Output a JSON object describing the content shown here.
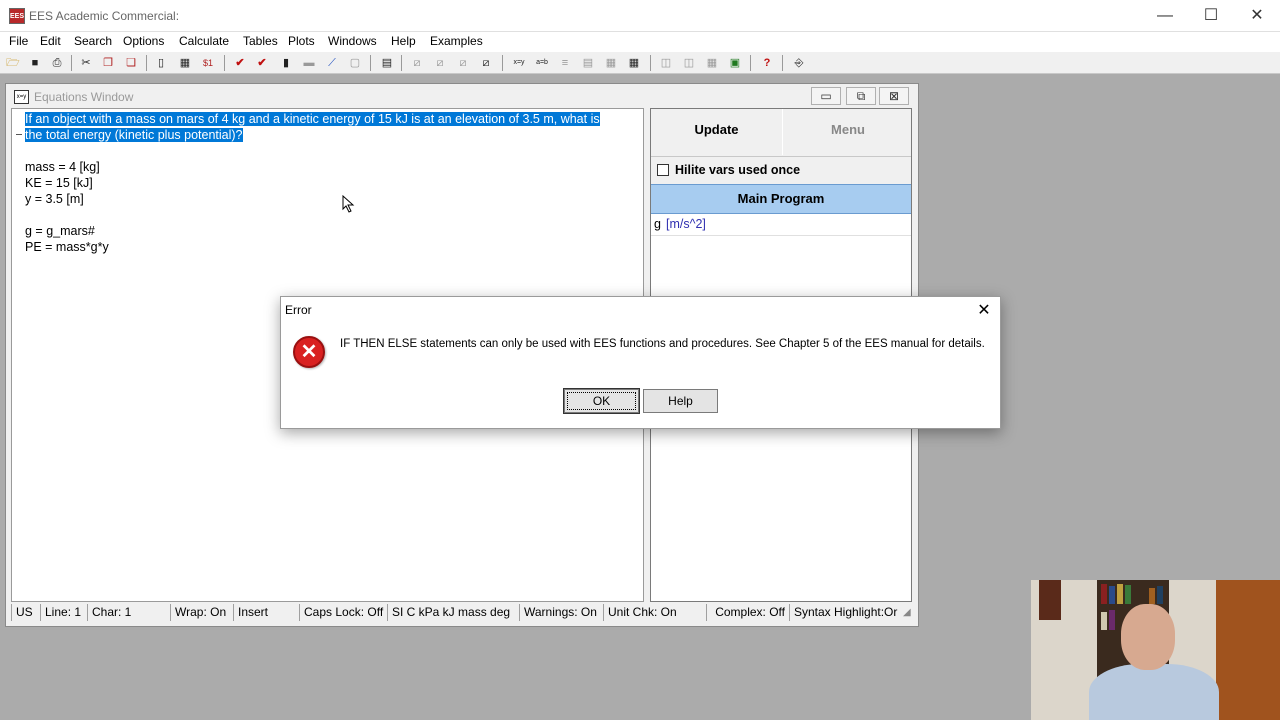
{
  "app": {
    "title": "EES Academic Commercial:",
    "icon_text": "EES",
    "controls": {
      "minimize": "—",
      "maximize": "☐",
      "close": "✕"
    }
  },
  "menu": [
    "File",
    "Edit",
    "Search",
    "Options",
    "Calculate",
    "Tables",
    "Plots",
    "Windows",
    "Help",
    "Examples"
  ],
  "toolbar": {
    "icons": [
      "open-icon",
      "save-icon",
      "print-icon",
      "cut-icon",
      "copy-icon",
      "paste-icon",
      "check-units-icon",
      "table-icon",
      "solve-icon",
      "solve-check-icon",
      "calculator-icon",
      "print-grey-icon",
      "plot-icon",
      "blank-icon",
      "grid-icon",
      "plot-window-icon",
      "plot2-icon",
      "plot3-icon",
      "plot4-icon",
      "xsy-icon",
      "unit-icon",
      "list-icon",
      "array-icon",
      "table2-icon",
      "table3-icon",
      "diagram-icon",
      "diagram2-icon",
      "lookup-icon",
      "image-icon",
      "help-icon",
      "exit-icon"
    ]
  },
  "equations_window": {
    "title": "Equations Window",
    "icon_text": "x=y",
    "controls": {
      "minimize": "▭",
      "restore": "⧉",
      "close": "⊠"
    },
    "lines": [
      "If an object with a mass on mars of 4 kg and a kinetic energy of 15 kJ is at an elevation of 3.5 m, what is",
      "the total energy (kinetic plus potential)?",
      "",
      "mass = 4 [kg]",
      "KE = 15 [kJ]",
      "y = 3.5 [m]",
      "",
      "g = g_mars#",
      "PE = mass*g*y"
    ]
  },
  "side_panel": {
    "tab_update": "Update",
    "tab_menu": "Menu",
    "hilite_label": "Hilite vars used once",
    "section_title": "Main Program",
    "var_name": "g",
    "var_unit": "[m/s^2]"
  },
  "status": [
    "US",
    "Line: 1",
    "Char: 1",
    "Wrap: On",
    "Insert",
    "Caps Lock: Off",
    "SI C kPa kJ mass deg",
    "Warnings: On",
    "Unit Chk: On",
    "Complex: Off",
    "Syntax Highlight:Or"
  ],
  "dialog": {
    "title": "Error",
    "close": "✕",
    "message": "IF THEN ELSE statements can only be used with EES functions and procedures.  See Chapter 5 of the EES manual for details.",
    "icon": "✕",
    "ok_label": "OK",
    "help_label": "Help"
  },
  "colors": {
    "selection": "#0078d7",
    "main_program": "#a7ccf0",
    "error_icon": "#d92121"
  }
}
